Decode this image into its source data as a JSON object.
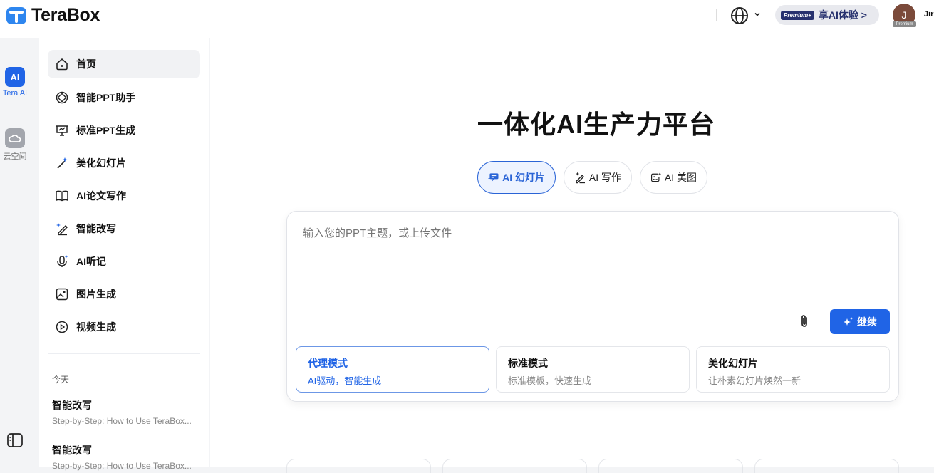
{
  "app": {
    "logo_text": "TeraBox"
  },
  "header": {
    "premium_badge": "Premium+",
    "premium_text": "享AI体验 >",
    "avatar_initial": "J",
    "avatar_badge": "Premium",
    "user_name": "Jir"
  },
  "rail": {
    "items": [
      {
        "label": "Tera AI",
        "icon": "ai-icon"
      },
      {
        "label": "云空间",
        "icon": "cloud-icon"
      }
    ]
  },
  "sidebar": {
    "nav": [
      {
        "label": "首页",
        "icon": "home-icon"
      },
      {
        "label": "智能PPT助手",
        "icon": "ppt-assistant-icon"
      },
      {
        "label": "标准PPT生成",
        "icon": "presentation-icon"
      },
      {
        "label": "美化幻灯片",
        "icon": "magic-wand-icon"
      },
      {
        "label": "AI论文写作",
        "icon": "book-icon"
      },
      {
        "label": "智能改写",
        "icon": "pen-sparkle-icon"
      },
      {
        "label": "AI听记",
        "icon": "microphone-icon"
      },
      {
        "label": "图片生成",
        "icon": "image-icon"
      },
      {
        "label": "视频生成",
        "icon": "video-icon"
      }
    ],
    "today_label": "今天",
    "history": [
      {
        "title": "智能改写",
        "subtitle": "Step-by-Step: How to Use TeraBox..."
      },
      {
        "title": "智能改写",
        "subtitle": "Step-by-Step: How to Use TeraBox..."
      }
    ]
  },
  "main": {
    "title": "一体化AI生产力平台",
    "tabs": [
      {
        "label": "AI 幻灯片",
        "icon": "slides-icon",
        "active": true
      },
      {
        "label": "AI 写作",
        "icon": "pen-icon",
        "active": false
      },
      {
        "label": "AI 美图",
        "icon": "image-sparkle-icon",
        "active": false
      }
    ],
    "prompt_placeholder": "输入您的PPT主题，或上传文件",
    "continue_label": "继续",
    "options": [
      {
        "title": "代理模式",
        "subtitle": "AI驱动，智能生成",
        "active": true
      },
      {
        "title": "标准模式",
        "subtitle": "标准模板，快速生成",
        "active": false
      },
      {
        "title": "美化幻灯片",
        "subtitle": "让朴素幻灯片焕然一新",
        "active": false
      }
    ]
  }
}
